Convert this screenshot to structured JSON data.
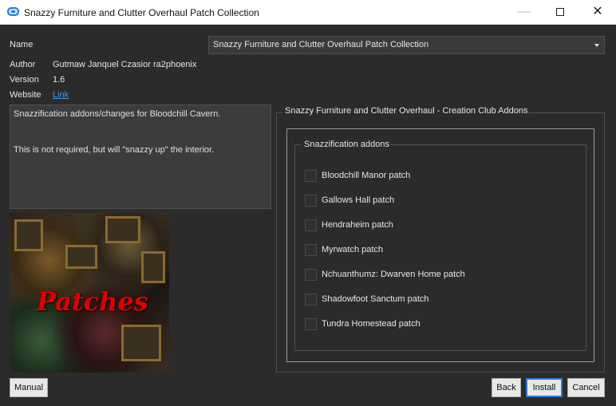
{
  "window": {
    "title": "Snazzy Furniture and Clutter Overhaul Patch Collection",
    "minimize_glyph": "—",
    "close_glyph": "✕"
  },
  "info": {
    "name_label": "Name",
    "name_value": "Snazzy Furniture and Clutter Overhaul Patch Collection",
    "author_label": "Author",
    "author_value": "Gutmaw Janquel Czasior ra2phoenix",
    "version_label": "Version",
    "version_value": "1.6",
    "website_label": "Website",
    "website_link": "Link"
  },
  "description": {
    "line1": "Snazzification addons/changes for Bloodchill Cavern.",
    "line2": "This is not required, but will \"snazzy up\" the interior."
  },
  "image": {
    "caption": "Patches"
  },
  "panel": {
    "outer_title": "Snazzy Furniture and Clutter Overhaul - Creation Club Addons",
    "inner_title": "Snazzification addons",
    "options": [
      {
        "label": "Bloodchill Manor patch",
        "checked": false
      },
      {
        "label": "Gallows Hall patch",
        "checked": false
      },
      {
        "label": "Hendraheim patch",
        "checked": false
      },
      {
        "label": "Myrwatch patch",
        "checked": false
      },
      {
        "label": "Nchuanthumz: Dwarven Home patch",
        "checked": false
      },
      {
        "label": "Shadowfoot Sanctum patch",
        "checked": false
      },
      {
        "label": "Tundra Homestead patch",
        "checked": false
      }
    ]
  },
  "buttons": {
    "manual": "Manual",
    "back": "Back",
    "install": "Install",
    "cancel": "Cancel"
  },
  "colors": {
    "background": "#2b2b2b",
    "link": "#3d9bf0",
    "accent_border": "#2a7ad6",
    "caption_red": "#e00000"
  }
}
